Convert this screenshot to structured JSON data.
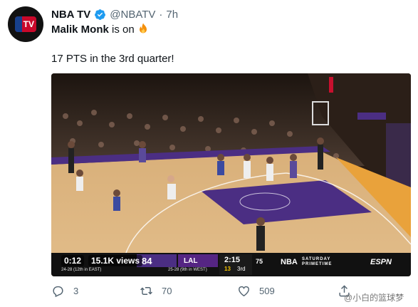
{
  "tweet": {
    "account_name": "NBA TV",
    "handle": "@NBATV",
    "separator": "·",
    "time": "7h",
    "line1_bold": "Malik Monk",
    "line1_rest": " is on ",
    "line2": "17 PTS in the 3rd quarter!",
    "avatar_text": "TV"
  },
  "video": {
    "timer": "0:12",
    "views": "15.1K views",
    "scorebug": {
      "away_score": "84",
      "away_record": "24-28 (12th in EAST)",
      "home_team": "LAL",
      "home_record": "25-28 (9th in WEST)",
      "clock": "2:15",
      "shot_clock": "13",
      "period": "3rd",
      "logo_75": "75",
      "logo_nba": "NBA",
      "show_line1": "SATURDAY",
      "show_line2": "PRIMETIME",
      "network": "ESPN"
    }
  },
  "actions": {
    "reply_count": "3",
    "retweet_count": "70",
    "like_count": "509"
  },
  "watermark": "@小白的篮球梦",
  "colors": {
    "accent": "#1d9bf0",
    "secondary_text": "#536471",
    "court_purple": "#4b2e83",
    "court_gold": "#e9a23b"
  }
}
